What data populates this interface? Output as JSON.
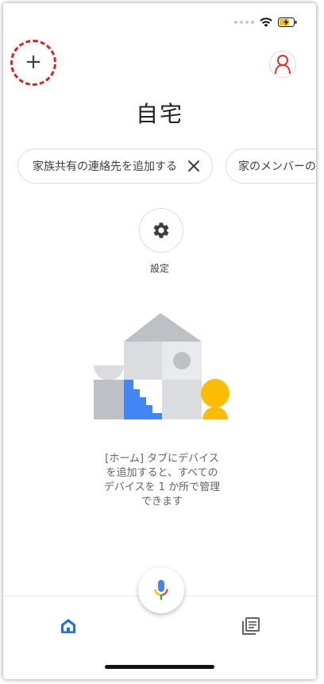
{
  "header": {
    "add_label": "+",
    "title": "自宅"
  },
  "chips": [
    {
      "label": "家族共有の連絡先を追加する",
      "closable": true
    },
    {
      "label": "家のメンバーの"
    }
  ],
  "settings": {
    "label": "設定"
  },
  "empty_state": {
    "line1": "[ホーム] タブにデバイス",
    "line2": "を追加すると、すべての",
    "line3": "デバイスを 1 か所で管理",
    "line4": "できます"
  },
  "icons": {
    "add": "plus-icon",
    "account": "account-icon",
    "close": "close-icon",
    "settings": "gear-icon",
    "mic": "microphone-icon",
    "home": "home-icon",
    "feed": "feed-icon"
  },
  "colors": {
    "annotation": "#e02020",
    "accent_blue": "#4285f4",
    "accent_yellow": "#fbbc04",
    "accent_red": "#ea4335",
    "accent_green": "#34a853",
    "illustration_gray": "#dadce0",
    "illustration_dark": "#bdc1c6"
  }
}
